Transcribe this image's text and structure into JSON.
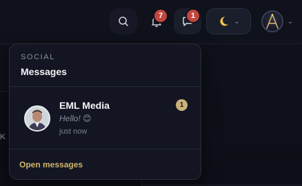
{
  "header": {
    "notifications_count": "7",
    "messages_count": "1"
  },
  "background": {
    "side_letter": "K"
  },
  "popover": {
    "caption": "SOCIAL",
    "title": "Messages",
    "messages": [
      {
        "sender": "EML Media",
        "preview": "Hello! 😊",
        "time": "just now",
        "unread": "1"
      }
    ],
    "open_link": "Open messages"
  },
  "colors": {
    "accent": "#d2b46a",
    "badge": "#c0463d",
    "unread_badge": "#c9b27a",
    "background": "#0f111b",
    "panel": "#131622"
  },
  "icons": [
    "search-icon",
    "bell-icon",
    "chat-bubble-icon",
    "moon-icon",
    "chevron-down-icon",
    "user-avatar"
  ]
}
